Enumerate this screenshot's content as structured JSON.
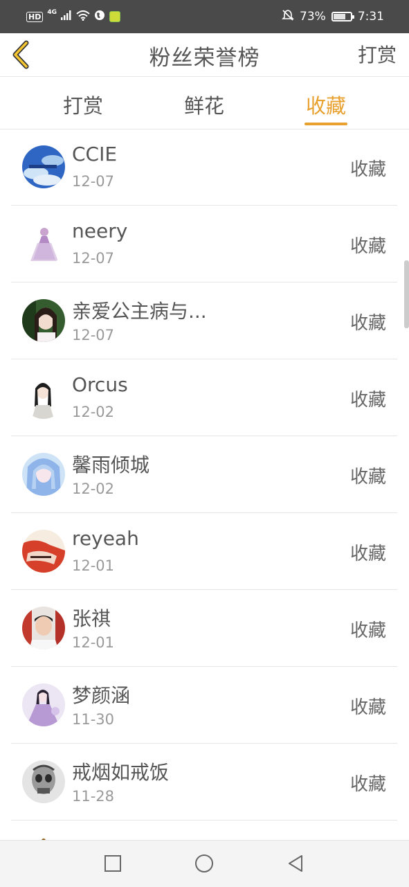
{
  "status_bar": {
    "hd_badge": "HD",
    "network": "4G",
    "battery_percent": "73%",
    "battery_level": 0.73,
    "time": "7:31",
    "icons": [
      "signal-icon",
      "wifi-icon",
      "globe-icon",
      "app-icon",
      "mute-icon",
      "battery-icon"
    ]
  },
  "nav": {
    "title": "粉丝荣誉榜",
    "action_label": "打赏",
    "back_icon": "chevron-left-icon",
    "accent_color": "#e8a02e"
  },
  "tabs": [
    {
      "label": "打赏",
      "active": false
    },
    {
      "label": "鲜花",
      "active": false
    },
    {
      "label": "收藏",
      "active": true
    }
  ],
  "fans": [
    {
      "name": "CCIE",
      "date": "12-07",
      "action": "收藏"
    },
    {
      "name": "neery",
      "date": "12-07",
      "action": "收藏"
    },
    {
      "name": "亲爱公主病与...",
      "date": "12-07",
      "action": "收藏"
    },
    {
      "name": "Orcus",
      "date": "12-02",
      "action": "收藏"
    },
    {
      "name": "馨雨倾城",
      "date": "12-02",
      "action": "收藏"
    },
    {
      "name": "reyeah",
      "date": "12-01",
      "action": "收藏"
    },
    {
      "name": "张祺",
      "date": "12-01",
      "action": "收藏"
    },
    {
      "name": "梦颜涵",
      "date": "11-30",
      "action": "收藏"
    },
    {
      "name": "戒烟如戒饭",
      "date": "11-28",
      "action": "收藏"
    }
  ],
  "system_nav": {
    "icons": [
      "square-recents-icon",
      "circle-home-icon",
      "triangle-back-icon"
    ]
  }
}
